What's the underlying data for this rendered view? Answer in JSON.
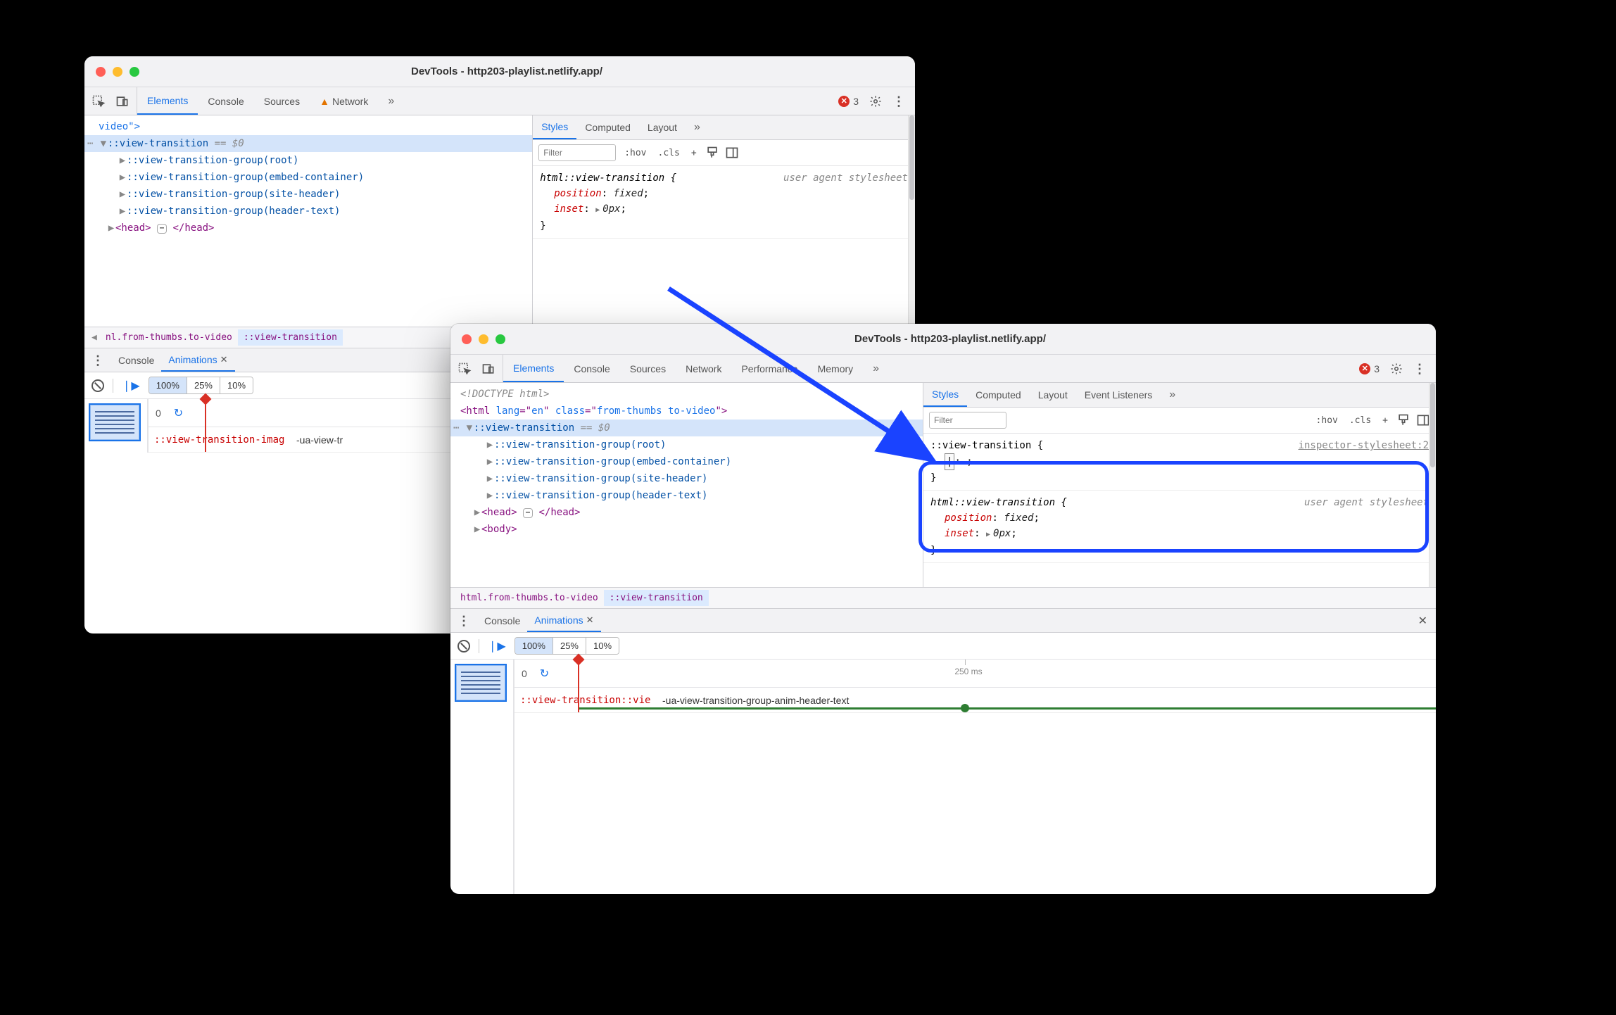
{
  "win1": {
    "title": "DevTools - http203-playlist.netlify.app/",
    "tabs": [
      "Elements",
      "Console",
      "Sources",
      "Network"
    ],
    "tabs_active": 0,
    "network_has_warning": true,
    "error_count": "3",
    "dom": {
      "line0": "video\">",
      "sel": "::view-transition",
      "sel_suffix": " == $0",
      "groups": [
        "::view-transition-group(root)",
        "::view-transition-group(embed-container)",
        "::view-transition-group(site-header)",
        "::view-transition-group(header-text)"
      ],
      "head_open": "<head>",
      "head_close": "</head>"
    },
    "crumbs": {
      "left_caret": "◀",
      "c1": "nl.from-thumbs.to-video",
      "c2": "::view-transition"
    },
    "styles": {
      "tabs": [
        "Styles",
        "Computed",
        "Layout"
      ],
      "active": 0,
      "filter": "Filter",
      "buttons": [
        ":hov",
        ".cls",
        "+"
      ],
      "rule_sel": "html::view-transition {",
      "rule_src": "user agent stylesheet",
      "props": [
        {
          "k": "position",
          "v": "fixed"
        },
        {
          "k": "inset",
          "v": "0px",
          "tri": true
        }
      ],
      "close": "}"
    },
    "drawer": {
      "tabs": [
        "Console",
        "Animations"
      ],
      "active": 1,
      "segs": [
        "100%",
        "25%",
        "10%"
      ],
      "seg_active": 0,
      "t0": "0",
      "row_label": "::view-transition-imag",
      "anim_name": "-ua-view-tr"
    }
  },
  "win2": {
    "title": "DevTools - http203-playlist.netlify.app/",
    "tabs": [
      "Elements",
      "Console",
      "Sources",
      "Network",
      "Performance",
      "Memory"
    ],
    "tabs_active": 0,
    "error_count": "3",
    "dom": {
      "doctype": "<!DOCTYPE html>",
      "html_open": "<html lang=\"en\" class=\"from-thumbs to-video\">",
      "sel": "::view-transition",
      "sel_suffix": " == $0",
      "groups": [
        "::view-transition-group(root)",
        "::view-transition-group(embed-container)",
        "::view-transition-group(site-header)",
        "::view-transition-group(header-text)"
      ],
      "head_open": "<head>",
      "head_close": "</head>",
      "body_open": "<body>"
    },
    "crumbs": {
      "c1": "html.from-thumbs.to-video",
      "c2": "::view-transition"
    },
    "styles": {
      "tabs": [
        "Styles",
        "Computed",
        "Layout",
        "Event Listeners"
      ],
      "active": 0,
      "filter": "Filter",
      "buttons": [
        ":hov",
        ".cls",
        "+"
      ],
      "new_rule_sel": "::view-transition {",
      "new_rule_src": "inspector-stylesheet:2",
      "new_rule_edit": ": ;",
      "new_rule_close": "}",
      "ua_sel": "html::view-transition {",
      "ua_src": "user agent stylesheet",
      "ua_props": [
        {
          "k": "position",
          "v": "fixed"
        },
        {
          "k": "inset",
          "v": "0px",
          "tri": true
        }
      ],
      "ua_close": "}"
    },
    "drawer": {
      "tabs": [
        "Console",
        "Animations"
      ],
      "active": 1,
      "segs": [
        "100%",
        "25%",
        "10%"
      ],
      "seg_active": 0,
      "t0": "0",
      "tick_label": "250 ms",
      "row_label": "::view-transition::vie",
      "anim_name": "-ua-view-transition-group-anim-header-text"
    }
  }
}
